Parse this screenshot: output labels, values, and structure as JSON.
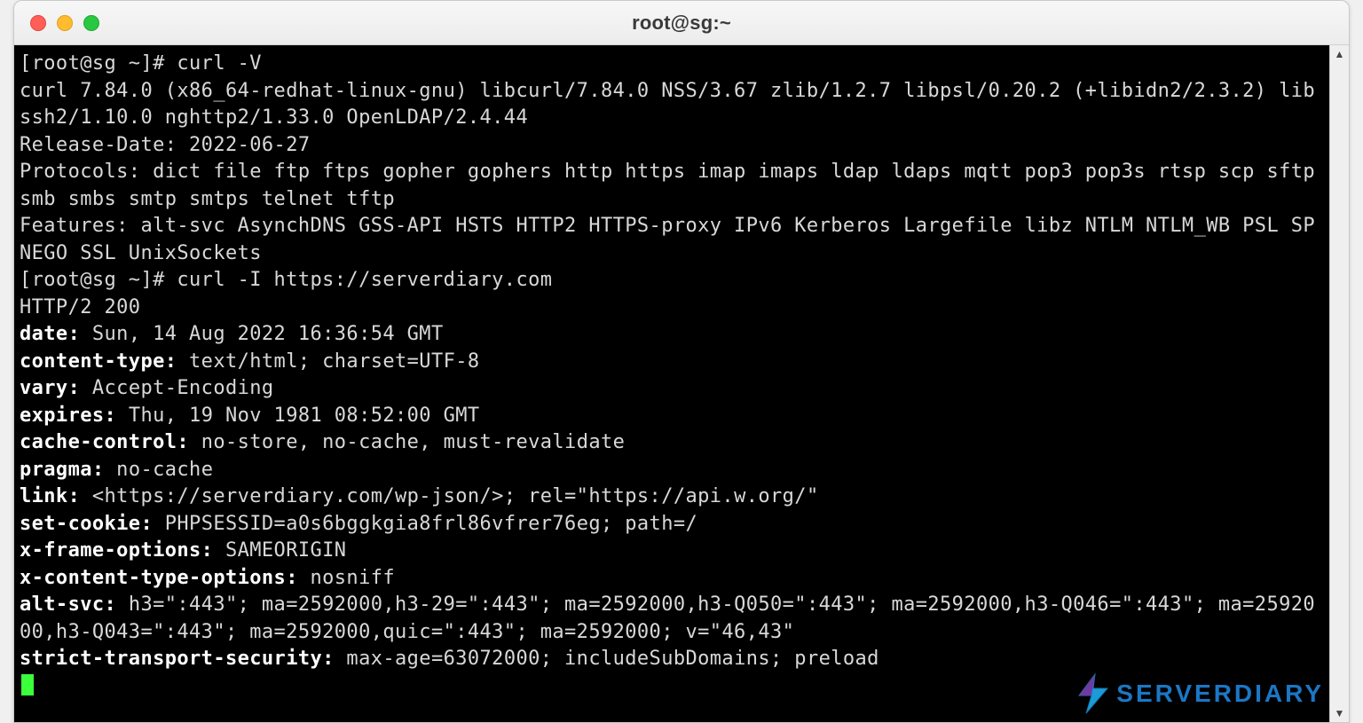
{
  "window": {
    "title": "root@sg:~"
  },
  "prompt1": "[root@sg ~]# ",
  "cmd1": "curl -V",
  "out1_l1": "curl 7.84.0 (x86_64-redhat-linux-gnu) libcurl/7.84.0 NSS/3.67 zlib/1.2.7 libpsl/0.20.2 (+libidn2/2.3.2) libssh2/1.10.0 nghttp2/1.33.0 OpenLDAP/2.4.44",
  "out1_l2": "Release-Date: 2022-06-27",
  "out1_l3": "Protocols: dict file ftp ftps gopher gophers http https imap imaps ldap ldaps mqtt pop3 pop3s rtsp scp sftp smb smbs smtp smtps telnet tftp ",
  "out1_l4": "Features: alt-svc AsynchDNS GSS-API HSTS HTTP2 HTTPS-proxy IPv6 Kerberos Largefile libz NTLM NTLM_WB PSL SPNEGO SSL UnixSockets",
  "prompt2": "[root@sg ~]# ",
  "cmd2": "curl -I https://serverdiary.com",
  "http_status": "HTTP/2 200 ",
  "hdr_date_k": "date:",
  "hdr_date_v": " Sun, 14 Aug 2022 16:36:54 GMT",
  "hdr_ct_k": "content-type:",
  "hdr_ct_v": " text/html; charset=UTF-8",
  "hdr_vary_k": "vary:",
  "hdr_vary_v": " Accept-Encoding",
  "hdr_exp_k": "expires:",
  "hdr_exp_v": " Thu, 19 Nov 1981 08:52:00 GMT",
  "hdr_cc_k": "cache-control:",
  "hdr_cc_v": " no-store, no-cache, must-revalidate",
  "hdr_prag_k": "pragma:",
  "hdr_prag_v": " no-cache",
  "hdr_link_k": "link:",
  "hdr_link_v": " <https://serverdiary.com/wp-json/>; rel=\"https://api.w.org/\"",
  "hdr_cookie_k": "set-cookie:",
  "hdr_cookie_v": " PHPSESSID=a0s6bggkgia8frl86vfrer76eg; path=/",
  "hdr_xfo_k": "x-frame-options:",
  "hdr_xfo_v": " SAMEORIGIN",
  "hdr_xcto_k": "x-content-type-options:",
  "hdr_xcto_v": " nosniff",
  "hdr_altsvc_k": "alt-svc:",
  "hdr_altsvc_v": " h3=\":443\"; ma=2592000,h3-29=\":443\"; ma=2592000,h3-Q050=\":443\"; ma=2592000,h3-Q046=\":443\"; ma=2592000,h3-Q043=\":443\"; ma=2592000,quic=\":443\"; ma=2592000; v=\"46,43\"",
  "hdr_sts_k": "strict-transport-security:",
  "hdr_sts_v": " max-age=63072000; includeSubDomains; preload",
  "watermark": "SERVERDIARY",
  "scroll": {
    "up_glyph": "▲",
    "down_glyph": "▼"
  }
}
